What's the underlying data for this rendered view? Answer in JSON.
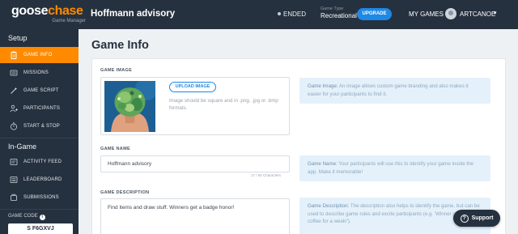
{
  "app": {
    "logo_main_a": "goose",
    "logo_main_b": "chase",
    "logo_sub": "Game Manager"
  },
  "header": {
    "game_title": "Hoffmann advisory",
    "status": "ENDED",
    "game_type_label": "Game Type",
    "game_type_value": "Recreational",
    "upgrade_label": "UPGRADE",
    "my_games_label": "MY GAMES",
    "username": "ARTCANOE",
    "caret": "▾"
  },
  "sidebar": {
    "setup_heading": "Setup",
    "setup_items": [
      {
        "label": "GAME INFO",
        "icon": "clipboard-icon",
        "active": true
      },
      {
        "label": "MISSIONS",
        "icon": "list-icon"
      },
      {
        "label": "GAME SCRIPT",
        "icon": "magic-wand-icon"
      },
      {
        "label": "PARTICIPANTS",
        "icon": "add-user-icon"
      },
      {
        "label": "START & STOP",
        "icon": "stopwatch-icon"
      }
    ],
    "ingame_heading": "In-Game",
    "ingame_items": [
      {
        "label": "ACTIVITY FEED",
        "icon": "feed-icon"
      },
      {
        "label": "LEADERBOARD",
        "icon": "leaderboard-icon"
      },
      {
        "label": "SUBMISSIONS",
        "icon": "submissions-icon"
      }
    ],
    "game_code_label": "GAME CODE",
    "game_code_value": "S F6GXVJ"
  },
  "main": {
    "page_title": "Game Info",
    "game_image": {
      "label": "GAME IMAGE",
      "upload_label": "UPLOAD IMAGE",
      "help_text": "Image should be square and in .png, .jpg or .bmp formats.",
      "tip_title": "Game Image:",
      "tip_text": "An image allows custom game branding and also makes it easier for your participants to find it."
    },
    "game_name": {
      "label": "GAME NAME",
      "value": "Hoffmann advisory",
      "char_count": "17 / 60 Characters",
      "tip_title": "Game Name:",
      "tip_text": "Your participants will use this to identify your game inside the app. Make it memorable!"
    },
    "game_description": {
      "label": "GAME DESCRIPTION",
      "value": "Find items and draw stuff. Winners get a badge honor!",
      "tip_title": "Game Description:",
      "tip_text": "The description also helps to identify the game, but can be used to describe game rules and excite participants (e.g. 'Winner gets free coffee for a week!')."
    }
  },
  "support_label": "Support",
  "colors": {
    "accent": "#ff8a00",
    "nav_bg": "#26313f",
    "primary": "#1e88e5",
    "tip_bg": "#e4f1fb"
  }
}
